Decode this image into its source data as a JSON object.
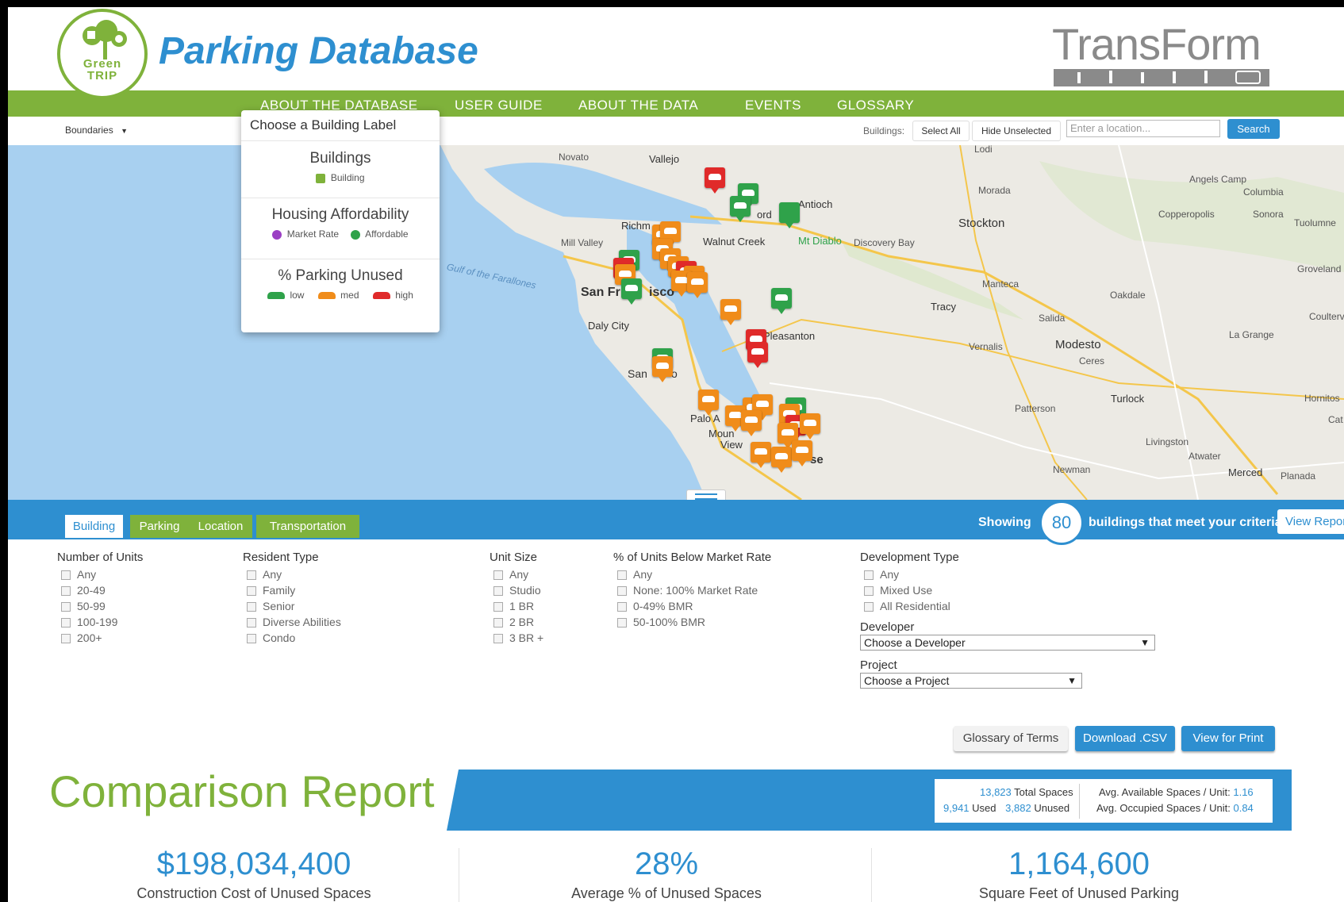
{
  "header": {
    "logo_text_line1": "Green",
    "logo_text_line2": "TRIP",
    "title": "Parking Database",
    "partner_logo": "TransForm"
  },
  "nav": {
    "items": [
      "ABOUT THE DATABASE",
      "USER GUIDE",
      "ABOUT THE DATA",
      "EVENTS",
      "GLOSSARY"
    ]
  },
  "toolbar": {
    "boundaries_label": "Boundaries",
    "buildings_label": "Buildings:",
    "select_all": "Select All",
    "hide_unselected": "Hide Unselected",
    "location_placeholder": "Enter a location...",
    "search": "Search"
  },
  "legend": {
    "heading": "Choose a Building Label",
    "buildings_title": "Buildings",
    "buildings_item": "Building",
    "affordability_title": "Housing Affordability",
    "market_rate": "Market Rate",
    "affordable": "Affordable",
    "parking_title": "% Parking Unused",
    "low": "low",
    "med": "med",
    "high": "high",
    "colors": {
      "low": "#2fa24a",
      "med": "#f08c1a",
      "high": "#e02a2a",
      "market": "#9b3fc4",
      "affordable": "#2fa24a"
    }
  },
  "map": {
    "labels": [
      "Novato",
      "Vallejo",
      "Lodi",
      "Angels Camp",
      "Columbia",
      "Morada",
      "Antioch",
      "ord",
      "Sonora",
      "Tuolumne",
      "Copperopolis",
      "Stockton",
      "Richm",
      "Walnut Creek",
      "Mt Diablo",
      "Discovery Bay",
      "Mill Valley",
      "Groveland",
      "Gulf of the Farallones",
      "Manteca",
      "San Fr",
      "isco",
      "Oakdale",
      "Coulterv",
      "Tracy",
      "Daly City",
      "Salida",
      "Pleasanton",
      "La Grange",
      "Vernalis",
      "Modesto",
      "Ceres",
      "San",
      "o",
      "Hornitos",
      "Turlock",
      "Patterson",
      "Palo A",
      "Cat",
      "Moun",
      "View",
      "Livingston",
      "se",
      "Atwater",
      "Newman",
      "Merced",
      "Planada"
    ]
  },
  "filters": {
    "tabs": [
      "Building",
      "Parking",
      "Location",
      "Transportation"
    ],
    "showing_pre": "Showing",
    "count": "80",
    "showing_post": "buildings that meet your criteria.",
    "view_report": "View Report",
    "number_of_units": {
      "title": "Number of Units",
      "options": [
        "Any",
        "20-49",
        "50-99",
        "100-199",
        "200+"
      ]
    },
    "resident_type": {
      "title": "Resident Type",
      "options": [
        "Any",
        "Family",
        "Senior",
        "Diverse Abilities",
        "Condo"
      ]
    },
    "unit_size": {
      "title": "Unit Size",
      "options": [
        "Any",
        "Studio",
        "1 BR",
        "2 BR",
        "3 BR +"
      ]
    },
    "bmr": {
      "title": "% of Units Below Market Rate",
      "options": [
        "Any",
        "None: 100% Market Rate",
        "0-49% BMR",
        "50-100% BMR"
      ]
    },
    "development_type": {
      "title": "Development Type",
      "options": [
        "Any",
        "Mixed Use",
        "All Residential"
      ]
    },
    "developer": {
      "label": "Developer",
      "selected": "Choose a Developer"
    },
    "project": {
      "label": "Project",
      "selected": "Choose a Project"
    }
  },
  "actions": {
    "glossary": "Glossary of Terms",
    "csv": "Download .CSV",
    "print": "View for Print"
  },
  "report": {
    "title": "Comparison Report",
    "total_spaces_num": "13,823",
    "total_spaces_label": "Total Spaces",
    "used_num": "9,941",
    "used_label": "Used",
    "unused_num": "3,882",
    "unused_label": "Unused",
    "avg_available_label": "Avg. Available Spaces / Unit:",
    "avg_available_num": "1.16",
    "avg_occupied_label": "Avg. Occupied Spaces / Unit:",
    "avg_occupied_num": "0.84",
    "stat1_value": "$198,034,400",
    "stat1_caption": "Construction Cost of Unused Spaces",
    "stat2_value": "28%",
    "stat2_caption": "Average % of Unused Spaces",
    "stat3_value": "1,164,600",
    "stat3_caption": "Square Feet of Unused Parking"
  }
}
